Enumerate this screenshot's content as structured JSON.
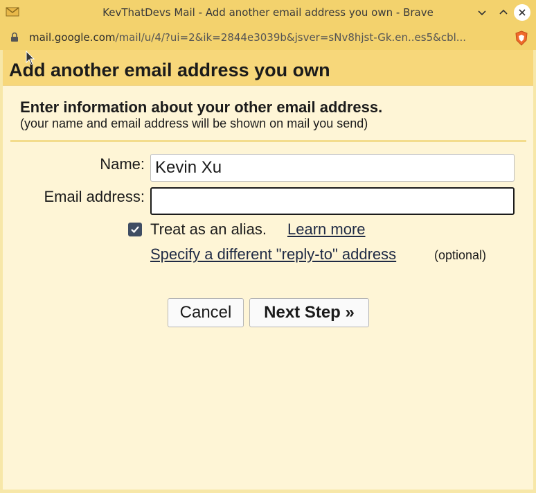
{
  "window": {
    "title": "KevThatDevs Mail - Add another email address you own - Brave",
    "url_host": "mail.google.com",
    "url_path": "/mail/u/4/?ui=2&ik=2844e3039b&jsver=sNv8hjst-Gk.en..es5&cbl..."
  },
  "dialog": {
    "title": "Add another email address you own",
    "heading": "Enter information about your other email address.",
    "subheading": "(your name and email address will be shown on mail you send)",
    "name_label": "Name:",
    "name_value": "Kevin Xu",
    "email_label": "Email address:",
    "email_value": "",
    "alias_checked": true,
    "alias_label": "Treat as an alias.",
    "learn_more": "Learn more",
    "reply_to_link": "Specify a different \"reply-to\" address",
    "optional": "(optional)",
    "cancel": "Cancel",
    "next_step": "Next Step »"
  },
  "colors": {
    "titlebar": "#f3d26d",
    "dialog_header": "#f7d77a",
    "dialog_body": "#fef5d6",
    "checkbox": "#3f4d63"
  },
  "icons": [
    "gmail-icon",
    "minimize-icon",
    "maximize-icon",
    "close-icon",
    "lock-icon",
    "brave-shield-icon",
    "cursor-icon",
    "checkmark-icon"
  ]
}
